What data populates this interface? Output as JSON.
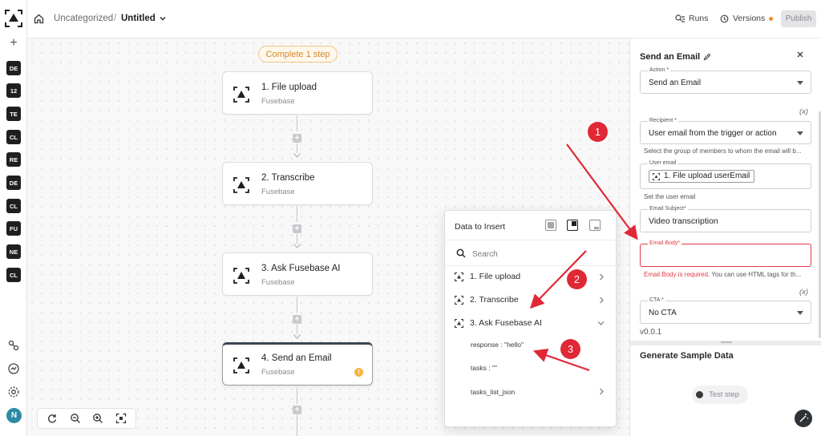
{
  "rail": {
    "badges": [
      "DE",
      "12",
      "TE",
      "CL",
      "RE",
      "DE",
      "CL",
      "FU",
      "NE",
      "CL"
    ],
    "avatar": "N"
  },
  "topbar": {
    "breadcrumb_parent": "Uncategorized",
    "breadcrumb_sep": "/",
    "breadcrumb_current": "Untitled",
    "runs_label": "Runs",
    "versions_label": "Versions",
    "publish_label": "Publish"
  },
  "canvas": {
    "status_pill": "Complete 1 step",
    "nodes": [
      {
        "title": "1. File upload",
        "subtitle": "Fusebase"
      },
      {
        "title": "2. Transcribe",
        "subtitle": "Fusebase"
      },
      {
        "title": "3. Ask Fusebase AI",
        "subtitle": "Fusebase"
      },
      {
        "title": "4. Send an Email",
        "subtitle": "Fusebase",
        "warning": "!"
      }
    ]
  },
  "popover": {
    "title": "Data to Insert",
    "search_placeholder": "Search",
    "items": [
      {
        "label": "1. File upload"
      },
      {
        "label": "2. Transcribe"
      },
      {
        "label": "3. Ask Fusebase AI"
      }
    ],
    "sub_items": [
      {
        "label": "response : \"hello\""
      },
      {
        "label": "tasks : \"\""
      },
      {
        "label": "tasks_list_json"
      }
    ]
  },
  "panel": {
    "title": "Send an Email",
    "var_token": "(x)",
    "action": {
      "label": "Action *",
      "value": "Send an Email"
    },
    "recipient": {
      "label": "Recipient *",
      "value": "User email from the trigger or action",
      "helper": "Select the group of members to whom the email will b..."
    },
    "user_email": {
      "label": "User email",
      "chip": "1. File upload userEmail",
      "helper": "Set the user email"
    },
    "email_subject": {
      "label": "Email Subject*",
      "value": "Video transcription"
    },
    "email_body": {
      "label": "Email Body*",
      "value": "",
      "error": "Email Body is required.",
      "error_rest": " You can use HTML tags for th..."
    },
    "cta": {
      "label": "CTA *",
      "value": "No CTA"
    },
    "version": "v0.0.1",
    "generate_title": "Generate Sample Data",
    "test_step_label": "Test step"
  },
  "annotations": {
    "badges": [
      "1",
      "2",
      "3"
    ],
    "color": "#e02836"
  }
}
